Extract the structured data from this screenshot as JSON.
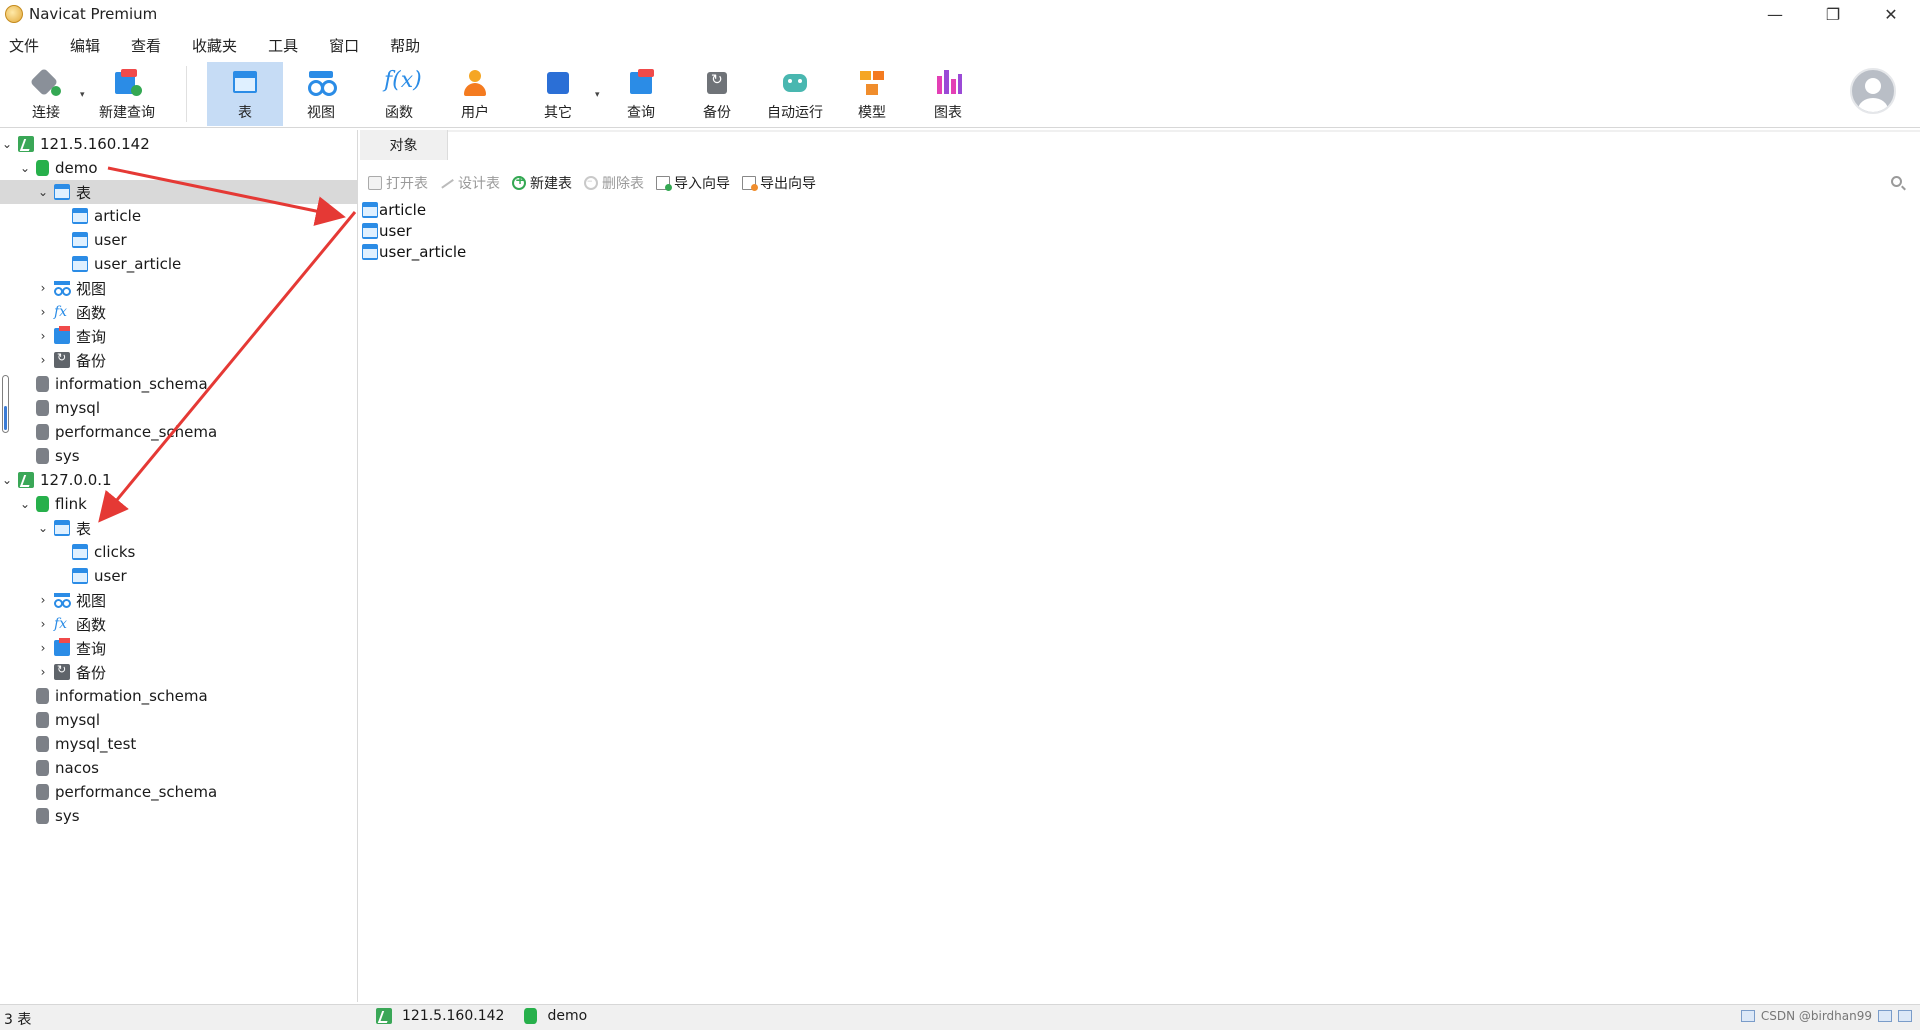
{
  "window": {
    "title": "Navicat Premium",
    "controls": {
      "minimize": "—",
      "restore": "❐",
      "close": "✕"
    }
  },
  "menu": [
    "文件",
    "编辑",
    "查看",
    "收藏夹",
    "工具",
    "窗口",
    "帮助"
  ],
  "toolbar": {
    "buttons": [
      {
        "label": "连接",
        "icon": "connect-icon"
      },
      {
        "label": "新建查询",
        "icon": "new-query-icon"
      },
      {
        "label": "表",
        "icon": "table-icon",
        "active": true
      },
      {
        "label": "视图",
        "icon": "view-icon"
      },
      {
        "label": "函数",
        "icon": "function-icon"
      },
      {
        "label": "用户",
        "icon": "user-icon"
      },
      {
        "label": "其它",
        "icon": "other-icon"
      },
      {
        "label": "查询",
        "icon": "query-icon"
      },
      {
        "label": "备份",
        "icon": "backup-icon"
      },
      {
        "label": "自动运行",
        "icon": "robot-icon"
      },
      {
        "label": "模型",
        "icon": "model-icon"
      },
      {
        "label": "图表",
        "icon": "chart-icon"
      }
    ],
    "fx_glyph": "f(x)"
  },
  "tree": {
    "conn1": {
      "name": "121.5.160.142",
      "db_demo": "demo",
      "tables_folder": "表",
      "tables": [
        "article",
        "user",
        "user_article"
      ],
      "views": "视图",
      "functions": "函数",
      "queries": "查询",
      "backups": "备份",
      "other_dbs": [
        "information_schema",
        "mysql",
        "performance_schema",
        "sys"
      ]
    },
    "conn2": {
      "name": "127.0.0.1",
      "db_flink": "flink",
      "tables_folder": "表",
      "tables": [
        "clicks",
        "user"
      ],
      "views": "视图",
      "functions": "函数",
      "queries": "查询",
      "backups": "备份",
      "other_dbs": [
        "information_schema",
        "mysql",
        "mysql_test",
        "nacos",
        "performance_schema",
        "sys"
      ]
    },
    "fx_glyph": "fx"
  },
  "objects_tab": "对象",
  "actions": {
    "open_table": "打开表",
    "design_table": "设计表",
    "new_table": "新建表",
    "delete_table": "删除表",
    "import_wizard": "导入向导",
    "export_wizard": "导出向导"
  },
  "object_list": [
    "article",
    "user",
    "user_article"
  ],
  "status": {
    "count": "3 表",
    "connection": "121.5.160.142",
    "database": "demo",
    "watermark": "CSDN @birdhan99"
  },
  "colors": {
    "active_tool": "#c6dcf5",
    "annotation_arrow": "#e53935",
    "selected_row": "#d9d9d9"
  }
}
